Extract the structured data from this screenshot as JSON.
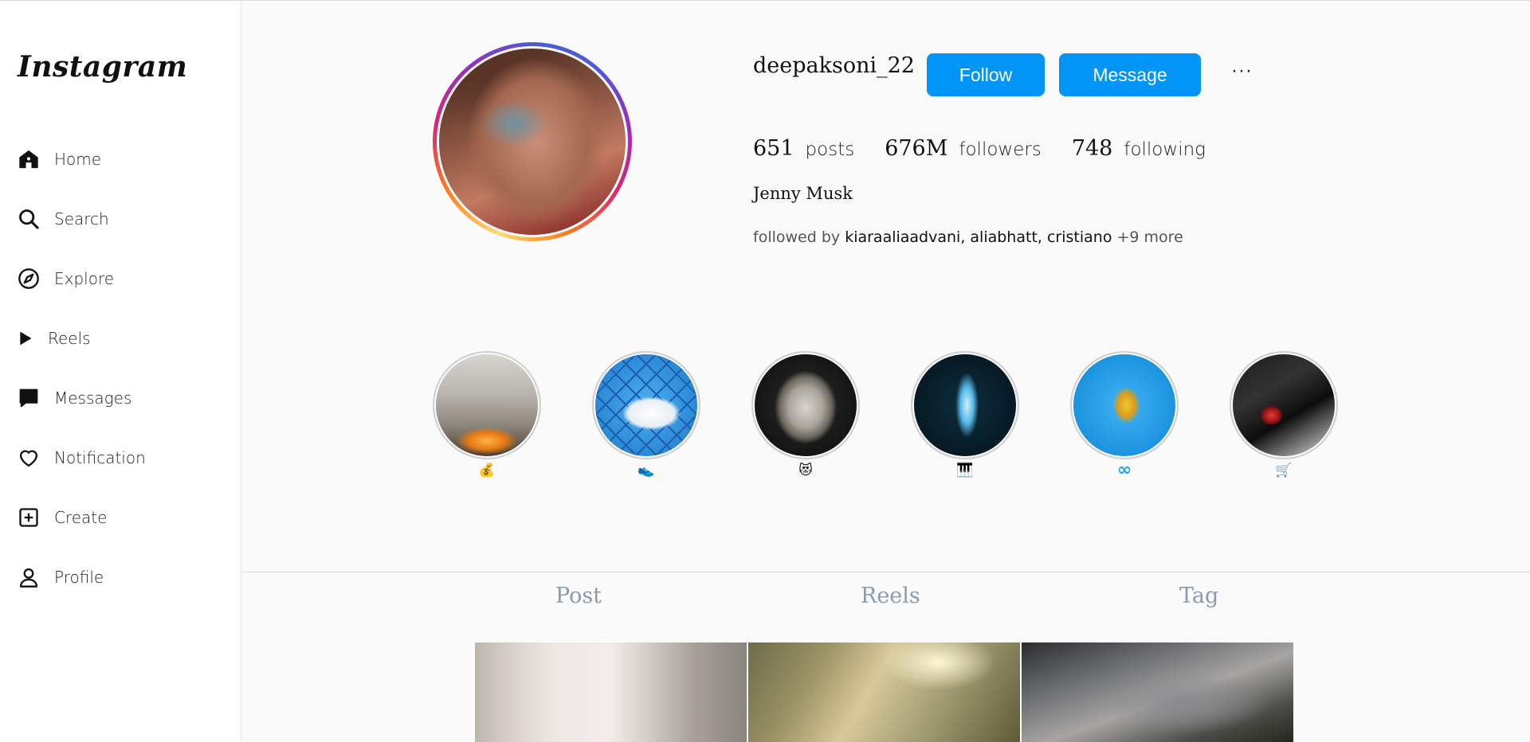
{
  "sidebar": {
    "logo": "Instagram",
    "items": [
      {
        "label": "Home",
        "icon": "home-icon"
      },
      {
        "label": "Search",
        "icon": "search-icon"
      },
      {
        "label": "Explore",
        "icon": "compass-icon"
      },
      {
        "label": "Reels",
        "icon": "play-icon"
      },
      {
        "label": "Messages",
        "icon": "message-icon"
      },
      {
        "label": "Notification",
        "icon": "heart-icon"
      },
      {
        "label": "Create",
        "icon": "plus-square-icon"
      },
      {
        "label": "Profile",
        "icon": "user-icon"
      }
    ]
  },
  "profile": {
    "username": "deepaksoni_22",
    "follow_label": "Follow",
    "message_label": "Message",
    "more_label": "···",
    "stats": {
      "posts_count": "651",
      "posts_label": "posts",
      "followers_count": "676M",
      "followers_label": "followers",
      "following_count": "748",
      "following_label": "following"
    },
    "full_name": "Jenny Musk",
    "followed_by_prefix": "followed by",
    "followed_by_names": "kiaraaliaadvani, aliabhatt, cristiano",
    "followed_by_more": "+9 more"
  },
  "highlights": [
    {
      "label": "💰"
    },
    {
      "label": "👟"
    },
    {
      "label": "😻"
    },
    {
      "label": "🎹"
    },
    {
      "label": "∞"
    },
    {
      "label": "🛒"
    }
  ],
  "tabs": {
    "post": "Post",
    "reels": "Reels",
    "tag": "Tag"
  },
  "colors": {
    "accent": "#0095f6",
    "background": "#fafafa",
    "tab_text": "#8a9ab0"
  }
}
